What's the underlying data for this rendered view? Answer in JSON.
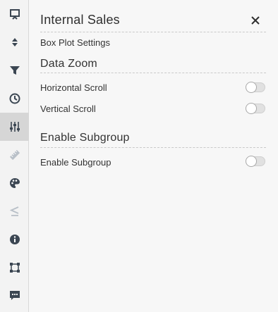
{
  "rail": {
    "items": [
      {
        "icon": "presentation-icon"
      },
      {
        "icon": "sort-arrows-icon"
      },
      {
        "icon": "filter-icon"
      },
      {
        "icon": "clock-icon"
      },
      {
        "icon": "sliders-icon",
        "active": true
      },
      {
        "icon": "ruler-icon"
      },
      {
        "icon": "palette-icon"
      },
      {
        "icon": "less-equal-icon"
      },
      {
        "icon": "info-icon"
      },
      {
        "icon": "selection-box-icon"
      },
      {
        "icon": "comment-icon"
      }
    ]
  },
  "panel": {
    "title": "Internal Sales",
    "close_icon": "close-icon",
    "subtitle": "Box Plot Settings",
    "sections": [
      {
        "heading": "Data Zoom",
        "rows": [
          {
            "label": "Horizontal Scroll",
            "enabled": false
          },
          {
            "label": "Vertical Scroll",
            "enabled": false
          }
        ]
      },
      {
        "heading": "Enable Subgroup",
        "rows": [
          {
            "label": "Enable Subgroup",
            "enabled": false
          }
        ]
      }
    ]
  },
  "colors": {
    "rail_bg": "#f3f3f3",
    "rail_active": "#d6d6d6",
    "icon_dark": "#3b4652",
    "icon_muted": "#b9c0c8",
    "panel_bg": "#f7f7f7",
    "toggle_off": "#e1e1e1"
  }
}
